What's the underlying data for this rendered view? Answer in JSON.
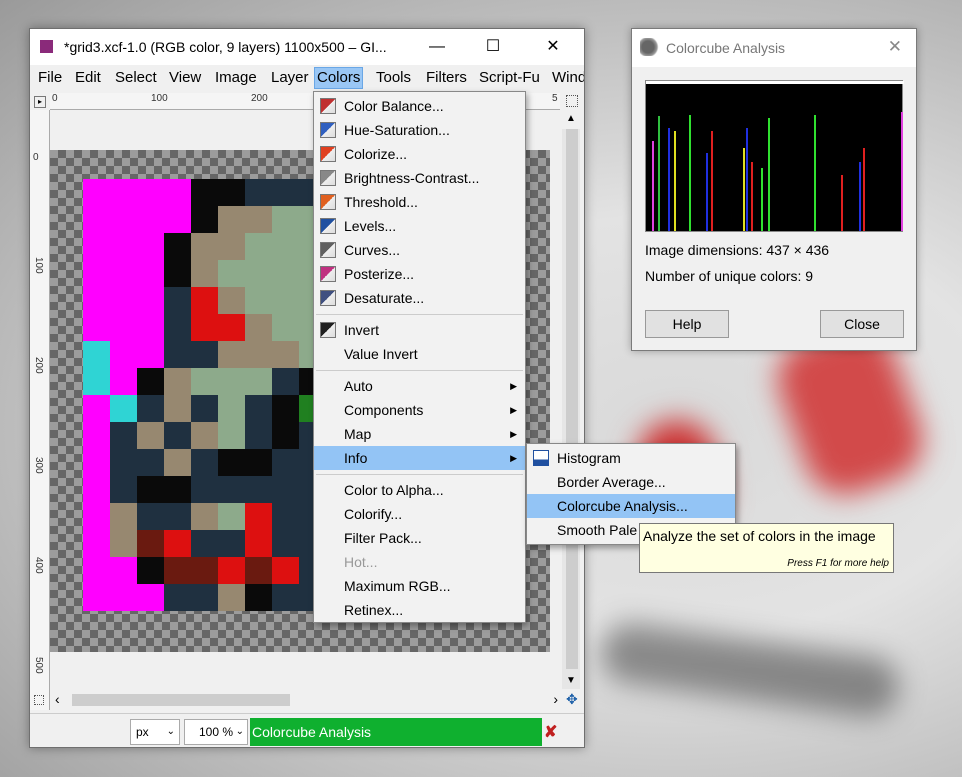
{
  "main_window": {
    "title": "*grid3.xcf-1.0 (RGB color, 9 layers) 1100x500 – GI...",
    "minimize": "—",
    "maximize": "☐",
    "close": "✕"
  },
  "menubar": [
    "File",
    "Edit",
    "Select",
    "View",
    "Image",
    "Layer",
    "Colors",
    "Tools",
    "Filters",
    "Script-Fu",
    "Windo"
  ],
  "rulers": {
    "top": [
      "0",
      "100",
      "200",
      "5"
    ],
    "left": [
      "0",
      "100",
      "200",
      "300",
      "400",
      "500"
    ]
  },
  "colors_menu": [
    {
      "label": "Color Balance...",
      "icon": "color-balance-icon",
      "color": "#c03030"
    },
    {
      "label": "Hue-Saturation...",
      "icon": "hue-saturation-icon",
      "color": "#3060c0"
    },
    {
      "label": "Colorize...",
      "icon": "colorize-icon",
      "color": "#e04020"
    },
    {
      "label": "Brightness-Contrast...",
      "icon": "brightness-contrast-icon",
      "color": "#888888"
    },
    {
      "label": "Threshold...",
      "icon": "threshold-icon",
      "color": "#e06020"
    },
    {
      "label": "Levels...",
      "icon": "levels-icon",
      "color": "#2050a0"
    },
    {
      "label": "Curves...",
      "icon": "curves-icon",
      "color": "#606060"
    },
    {
      "label": "Posterize...",
      "icon": "posterize-icon",
      "color": "#c03080"
    },
    {
      "label": "Desaturate...",
      "icon": "desaturate-icon",
      "color": "#405080"
    },
    {
      "label": "Invert",
      "icon": "invert-icon",
      "color": "#202020"
    },
    {
      "label": "Value Invert",
      "icon": "",
      "color": ""
    },
    {
      "label": "Auto",
      "icon": "",
      "color": ""
    },
    {
      "label": "Components",
      "icon": "",
      "color": ""
    },
    {
      "label": "Map",
      "icon": "",
      "color": ""
    },
    {
      "label": "Info",
      "icon": "",
      "color": ""
    },
    {
      "label": "Color to Alpha...",
      "icon": "",
      "color": ""
    },
    {
      "label": "Colorify...",
      "icon": "",
      "color": ""
    },
    {
      "label": "Filter Pack...",
      "icon": "",
      "color": ""
    },
    {
      "label": "Hot...",
      "icon": "",
      "color": ""
    },
    {
      "label": "Maximum RGB...",
      "icon": "",
      "color": ""
    },
    {
      "label": "Retinex...",
      "icon": "",
      "color": ""
    }
  ],
  "info_submenu": [
    {
      "label": "Histogram",
      "icon": "histogram-icon"
    },
    {
      "label": "Border Average...",
      "icon": ""
    },
    {
      "label": "Colorcube Analysis...",
      "icon": ""
    },
    {
      "label": "Smooth Pale",
      "icon": ""
    }
  ],
  "tooltip": {
    "text": "Analyze the set of colors in the image",
    "help": "Press F1 for more help"
  },
  "statusbar": {
    "unit": "px",
    "zoom": "100 %",
    "message": "Colorcube Analysis"
  },
  "colorcube_dialog": {
    "title": "Colorcube Analysis",
    "dimensions": "Image dimensions: 437 × 436",
    "unique_colors": "Number of unique colors: 9",
    "help_button": "Help",
    "close_button": "Close",
    "close_icon": "✕"
  },
  "image_palette": {
    "M": "#ff00ff",
    "C": "#2fd4d4",
    "K": "#0a0a0a",
    "N": "#1f3040",
    "T": "#978870",
    "G": "#8daa8b",
    "R": "#dd1010",
    "D": "#6a1a10",
    "g": "#208020"
  },
  "image_rows": [
    "MMMMKKNNN",
    "MMMMKTTGG",
    "MMMKTTGGG",
    "MMMKTGGGG",
    "MMMNRTGGG",
    "MMMNRRTGG",
    "CMMNNTTTG",
    "CMKTGGGNK",
    "MCNTNGNKg",
    "MNTNTGNKN",
    "MNNTNKKNN",
    "MNKKNNNNN",
    "MTNNTGRNN",
    "MTDRNNRNN",
    "MMKDDRDRN",
    "MMMNNTKNN"
  ]
}
